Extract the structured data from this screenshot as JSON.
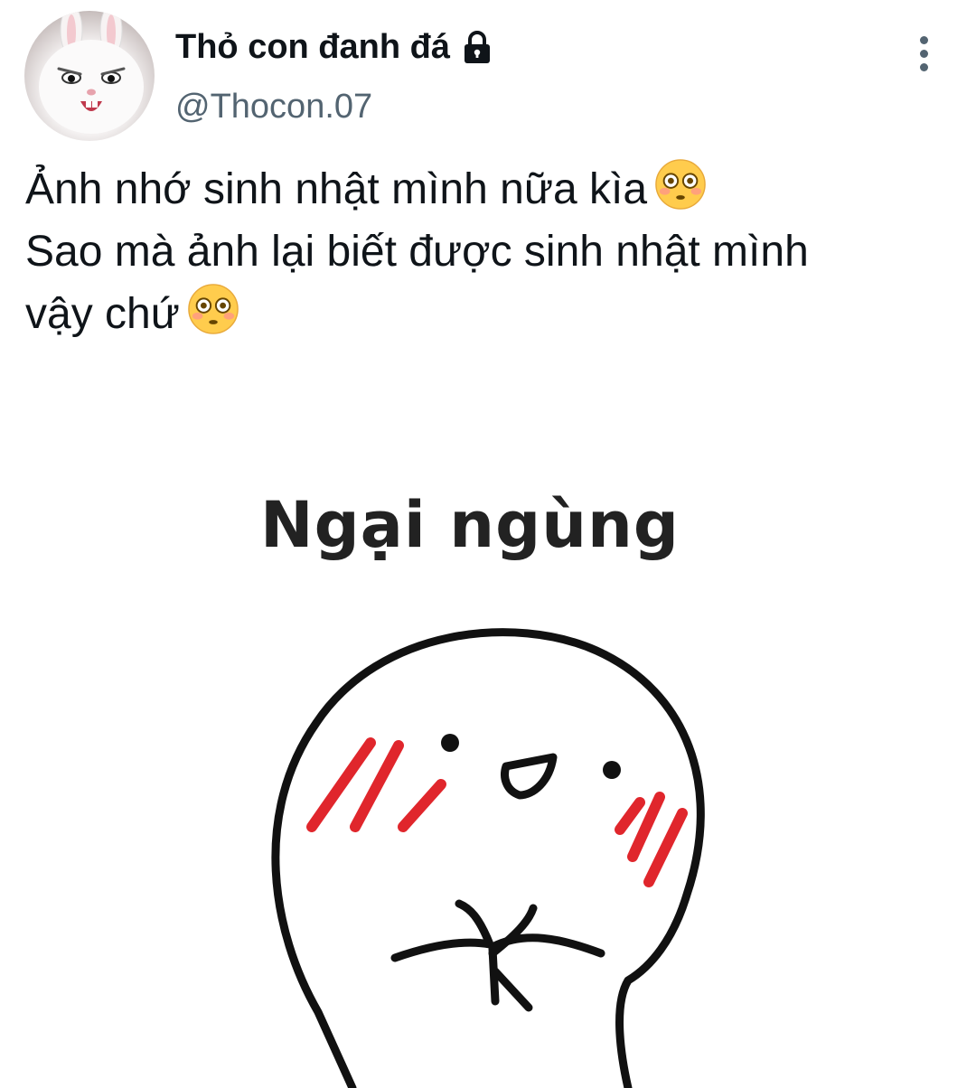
{
  "author": {
    "display_name": "Thỏ con đanh đá",
    "handle": "@Thocon.07",
    "avatar_icon": "rabbit-avatar",
    "protected_icon": "lock-icon"
  },
  "menu": {
    "icon": "more-vertical-icon"
  },
  "tweet": {
    "lines": [
      "Ảnh nhớ sinh nhật mình nữa kìa",
      "Sao mà ảnh lại biết được sinh nhật mình",
      "vậy chứ"
    ],
    "emoji_icon": "flushed-face-emoji"
  },
  "media": {
    "caption": "Ngại ngùng",
    "illustration_icon": "shy-blushing-character"
  },
  "colors": {
    "text": "#0f1419",
    "secondary_text": "#536471",
    "blush": "#e0262c"
  }
}
